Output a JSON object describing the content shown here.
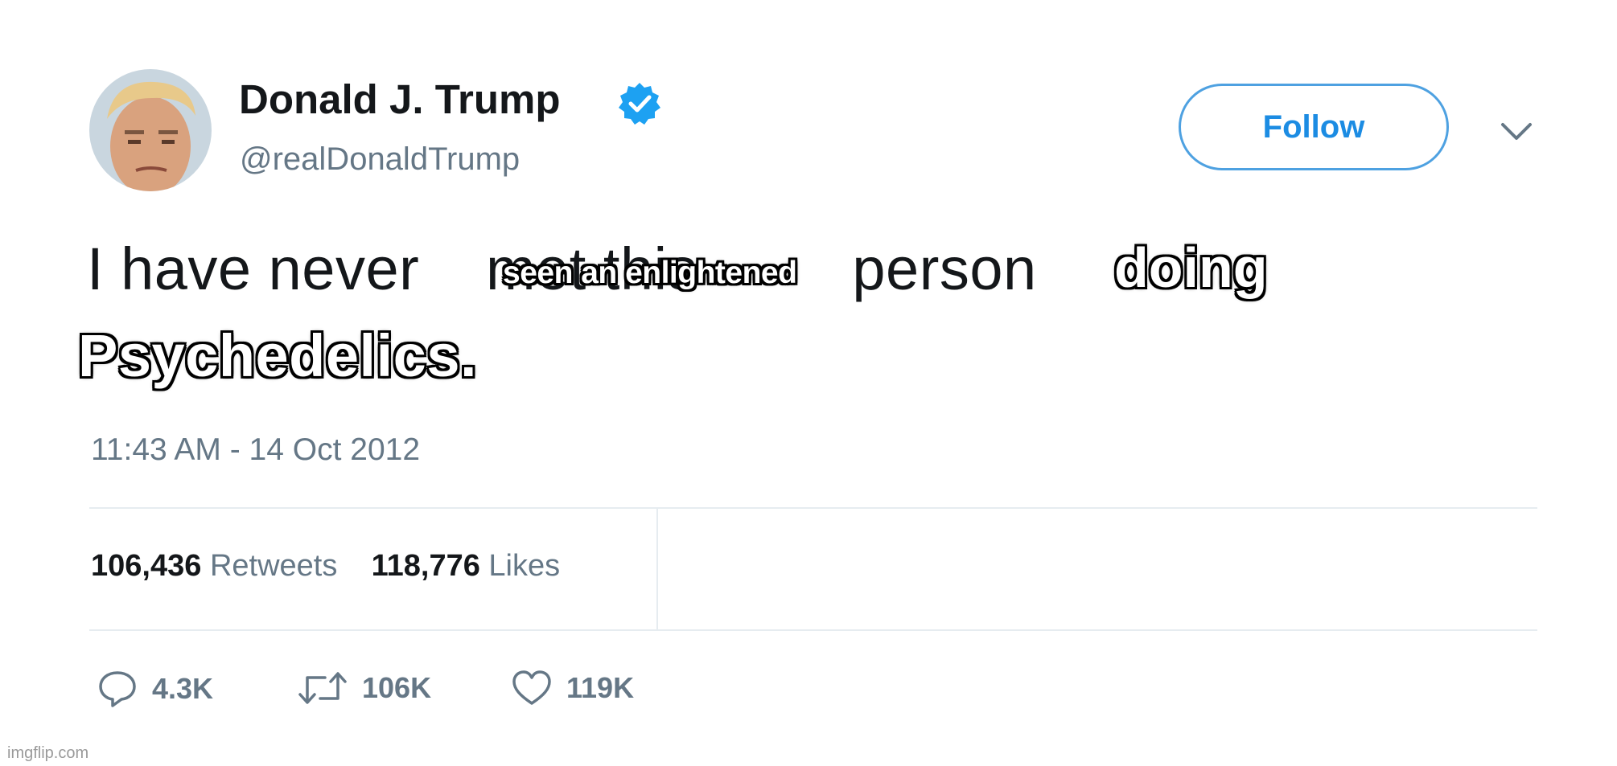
{
  "author": {
    "name": "Donald J. Trump",
    "handle": "@realDonaldTrump",
    "verified": true,
    "avatar_icon": "avatar-photo"
  },
  "follow_button": {
    "label": "Follow"
  },
  "menu_icon": "chevron-down-icon",
  "tweet": {
    "line1_start": "I have never",
    "line1_obscured": "met this",
    "line1_end": "person"
  },
  "meme_captions": {
    "caption_small": "seen an enlightened",
    "caption_doing": "doing",
    "caption_psychedelics": "Psychedelics."
  },
  "timestamp": "11:43 AM - 14 Oct 2012",
  "stats": {
    "retweets_count": "106,436",
    "retweets_label": "Retweets",
    "likes_count": "118,776",
    "likes_label": "Likes"
  },
  "actions": {
    "reply_count": "4.3K",
    "retweet_count": "106K",
    "like_count": "119K"
  },
  "watermark": "imgflip.com",
  "colors": {
    "accent": "#1da1f2",
    "text": "#14171a",
    "muted": "#657786",
    "divider": "#e6ecf0"
  }
}
